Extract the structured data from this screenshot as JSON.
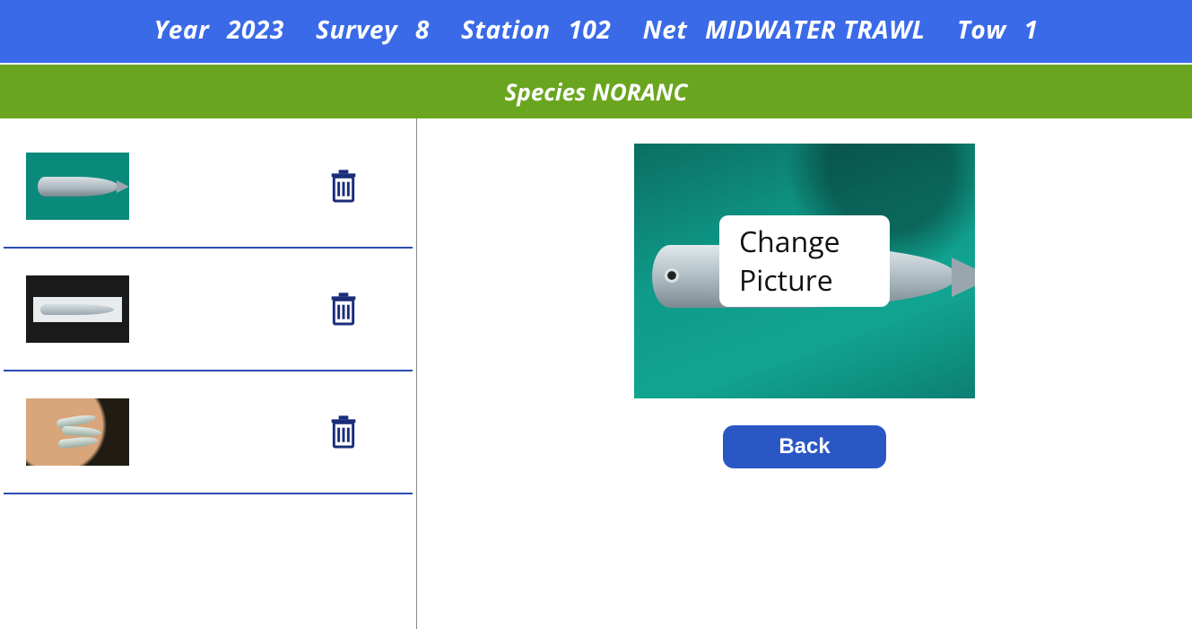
{
  "header": {
    "year_label": "Year",
    "year_value": "2023",
    "survey_label": "Survey",
    "survey_value": "8",
    "station_label": "Station",
    "station_value": "102",
    "net_label": "Net",
    "net_value": "MIDWATER TRAWL",
    "tow_label": "Tow",
    "tow_value": "1"
  },
  "species_bar": {
    "label": "Species",
    "value": "NORANC"
  },
  "thumbnails": [
    {
      "icon": "fish-on-teal-board"
    },
    {
      "icon": "fish-on-dark-strip"
    },
    {
      "icon": "small-fish-in-hand"
    }
  ],
  "preview": {
    "change_label": "Change Picture"
  },
  "actions": {
    "back_label": "Back"
  },
  "icons": {
    "trash": "trash-icon"
  }
}
